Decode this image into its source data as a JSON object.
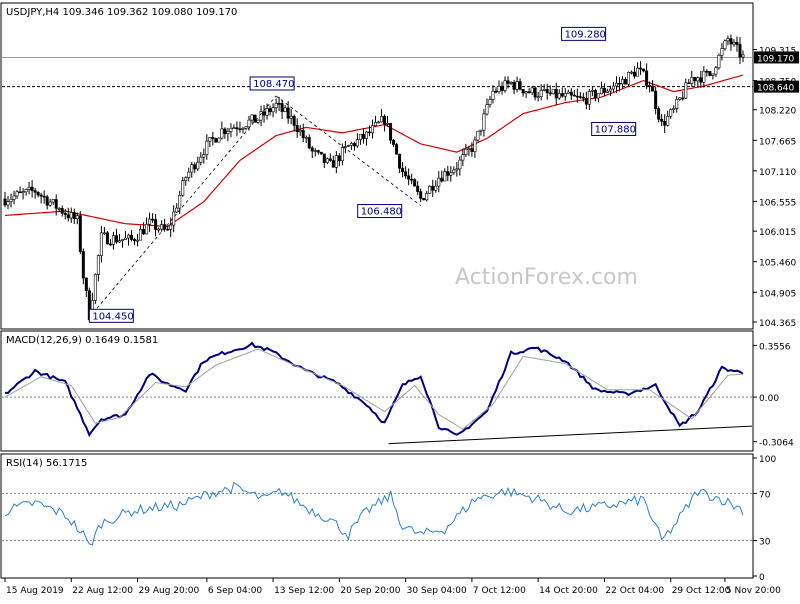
{
  "header": {
    "main": "USDJPY,H4  109.346 109.362 109.080 109.170",
    "macd": "MACD(12,26,9) 0.1649 0.1581",
    "rsi": "RSI(14) 56.1715"
  },
  "watermark": "ActionForex.com",
  "colors": {
    "candle": "#000000",
    "ma": "#d40000",
    "macd_main": "#00007f",
    "macd_signal": "#a0a0a0",
    "rsi": "#2a7fd4",
    "label_border": "#00007f",
    "label_text": "#00007f",
    "grid_dotted": "#888888",
    "watermark": "#c8c8c8"
  },
  "chart_data": [
    {
      "type": "candlestick",
      "panel": "price",
      "ylim": [
        104.365,
        109.85
      ],
      "y_ticks": [
        "109.315",
        "108.750",
        "108.220",
        "107.665",
        "107.110",
        "106.555",
        "106.015",
        "105.460",
        "104.905",
        "104.365"
      ],
      "price_tags": [
        {
          "value": 109.17,
          "label": "109.170",
          "line": "solid"
        },
        {
          "value": 108.64,
          "label": "108.640",
          "line": "dashed"
        }
      ],
      "annotations": [
        {
          "text": "104.450",
          "price": 104.45
        },
        {
          "text": "108.470",
          "price": 108.47
        },
        {
          "text": "106.480",
          "price": 106.48
        },
        {
          "text": "109.280",
          "price": 109.28
        },
        {
          "text": "107.880",
          "price": 107.88
        }
      ],
      "anchors": [
        {
          "i": 0,
          "p": 106.6
        },
        {
          "i": 10,
          "p": 106.75
        },
        {
          "i": 16,
          "p": 106.5
        },
        {
          "i": 24,
          "p": 106.2
        },
        {
          "i": 26,
          "p": 105.2
        },
        {
          "i": 28,
          "p": 104.5
        },
        {
          "i": 32,
          "p": 105.9
        },
        {
          "i": 42,
          "p": 105.85
        },
        {
          "i": 48,
          "p": 106.15
        },
        {
          "i": 54,
          "p": 106.0
        },
        {
          "i": 60,
          "p": 107.0
        },
        {
          "i": 66,
          "p": 107.5
        },
        {
          "i": 72,
          "p": 107.85
        },
        {
          "i": 78,
          "p": 107.95
        },
        {
          "i": 84,
          "p": 108.05
        },
        {
          "i": 90,
          "p": 108.3
        },
        {
          "i": 96,
          "p": 108.0
        },
        {
          "i": 102,
          "p": 107.45
        },
        {
          "i": 108,
          "p": 107.2
        },
        {
          "i": 114,
          "p": 107.55
        },
        {
          "i": 120,
          "p": 107.75
        },
        {
          "i": 126,
          "p": 108.05
        },
        {
          "i": 132,
          "p": 107.1
        },
        {
          "i": 138,
          "p": 106.6
        },
        {
          "i": 144,
          "p": 107.0
        },
        {
          "i": 150,
          "p": 107.2
        },
        {
          "i": 156,
          "p": 107.6
        },
        {
          "i": 162,
          "p": 108.55
        },
        {
          "i": 168,
          "p": 108.7
        },
        {
          "i": 174,
          "p": 108.55
        },
        {
          "i": 180,
          "p": 108.5
        },
        {
          "i": 186,
          "p": 108.45
        },
        {
          "i": 192,
          "p": 108.4
        },
        {
          "i": 198,
          "p": 108.55
        },
        {
          "i": 204,
          "p": 108.7
        },
        {
          "i": 210,
          "p": 108.95
        },
        {
          "i": 214,
          "p": 108.7
        },
        {
          "i": 218,
          "p": 107.95
        },
        {
          "i": 222,
          "p": 108.2
        },
        {
          "i": 228,
          "p": 108.8
        },
        {
          "i": 234,
          "p": 108.85
        },
        {
          "i": 240,
          "p": 109.5
        },
        {
          "i": 245,
          "p": 109.17
        }
      ],
      "ma_anchors": [
        {
          "i": 0,
          "p": 106.3
        },
        {
          "i": 20,
          "p": 106.38
        },
        {
          "i": 40,
          "p": 106.15
        },
        {
          "i": 54,
          "p": 106.1
        },
        {
          "i": 66,
          "p": 106.55
        },
        {
          "i": 78,
          "p": 107.3
        },
        {
          "i": 90,
          "p": 107.75
        },
        {
          "i": 100,
          "p": 107.9
        },
        {
          "i": 112,
          "p": 107.8
        },
        {
          "i": 126,
          "p": 107.95
        },
        {
          "i": 138,
          "p": 107.6
        },
        {
          "i": 150,
          "p": 107.45
        },
        {
          "i": 160,
          "p": 107.7
        },
        {
          "i": 172,
          "p": 108.15
        },
        {
          "i": 186,
          "p": 108.35
        },
        {
          "i": 198,
          "p": 108.45
        },
        {
          "i": 212,
          "p": 108.75
        },
        {
          "i": 222,
          "p": 108.55
        },
        {
          "i": 232,
          "p": 108.65
        },
        {
          "i": 245,
          "p": 108.85
        }
      ],
      "trendlines": [
        {
          "from": {
            "i": 28,
            "p": 104.45
          },
          "to": {
            "i": 90,
            "p": 108.47
          }
        },
        {
          "from": {
            "i": 90,
            "p": 108.47
          },
          "to": {
            "i": 138,
            "p": 106.48
          }
        }
      ]
    },
    {
      "type": "line",
      "panel": "macd",
      "ylim": [
        -0.35,
        0.42
      ],
      "y_ticks": [
        {
          "label": "0.3556",
          "value": 0.3556
        },
        {
          "label": "0.00",
          "value": 0.0
        },
        {
          "label": "-0.3064",
          "value": -0.3064
        }
      ],
      "series": [
        {
          "role": "main",
          "anchors": [
            {
              "i": 0,
              "p": 0.02
            },
            {
              "i": 10,
              "p": 0.18
            },
            {
              "i": 20,
              "p": 0.1
            },
            {
              "i": 28,
              "p": -0.25
            },
            {
              "i": 32,
              "p": -0.15
            },
            {
              "i": 40,
              "p": -0.12
            },
            {
              "i": 48,
              "p": 0.16
            },
            {
              "i": 54,
              "p": 0.09
            },
            {
              "i": 60,
              "p": 0.05
            },
            {
              "i": 66,
              "p": 0.25
            },
            {
              "i": 72,
              "p": 0.3
            },
            {
              "i": 82,
              "p": 0.36
            },
            {
              "i": 88,
              "p": 0.32
            },
            {
              "i": 100,
              "p": 0.18
            },
            {
              "i": 110,
              "p": 0.1
            },
            {
              "i": 120,
              "p": -0.05
            },
            {
              "i": 126,
              "p": -0.18
            },
            {
              "i": 132,
              "p": 0.08
            },
            {
              "i": 138,
              "p": 0.15
            },
            {
              "i": 144,
              "p": -0.2
            },
            {
              "i": 150,
              "p": -0.27
            },
            {
              "i": 160,
              "p": -0.1
            },
            {
              "i": 168,
              "p": 0.3
            },
            {
              "i": 176,
              "p": 0.34
            },
            {
              "i": 186,
              "p": 0.25
            },
            {
              "i": 196,
              "p": 0.05
            },
            {
              "i": 206,
              "p": 0.02
            },
            {
              "i": 216,
              "p": 0.08
            },
            {
              "i": 224,
              "p": -0.2
            },
            {
              "i": 230,
              "p": -0.1
            },
            {
              "i": 238,
              "p": 0.2
            },
            {
              "i": 245,
              "p": 0.165
            }
          ]
        },
        {
          "role": "signal",
          "anchors": [
            {
              "i": 0,
              "p": 0.0
            },
            {
              "i": 12,
              "p": 0.14
            },
            {
              "i": 22,
              "p": 0.08
            },
            {
              "i": 30,
              "p": -0.18
            },
            {
              "i": 38,
              "p": -0.14
            },
            {
              "i": 50,
              "p": 0.1
            },
            {
              "i": 60,
              "p": 0.07
            },
            {
              "i": 70,
              "p": 0.22
            },
            {
              "i": 84,
              "p": 0.33
            },
            {
              "i": 96,
              "p": 0.22
            },
            {
              "i": 112,
              "p": 0.08
            },
            {
              "i": 126,
              "p": -0.1
            },
            {
              "i": 136,
              "p": 0.08
            },
            {
              "i": 144,
              "p": -0.12
            },
            {
              "i": 152,
              "p": -0.22
            },
            {
              "i": 162,
              "p": -0.05
            },
            {
              "i": 172,
              "p": 0.28
            },
            {
              "i": 186,
              "p": 0.23
            },
            {
              "i": 200,
              "p": 0.05
            },
            {
              "i": 214,
              "p": 0.05
            },
            {
              "i": 228,
              "p": -0.15
            },
            {
              "i": 240,
              "p": 0.15
            },
            {
              "i": 245,
              "p": 0.158
            }
          ]
        }
      ],
      "trendline": {
        "from": {
          "i": 134,
          "p": -0.32
        },
        "to": {
          "i": 248,
          "p": -0.2
        }
      }
    },
    {
      "type": "line",
      "panel": "rsi",
      "ylim": [
        0,
        100
      ],
      "y_ticks": [
        {
          "label": "100",
          "value": 100
        },
        {
          "label": "70",
          "value": 70
        },
        {
          "label": "30",
          "value": 30
        },
        {
          "label": "0",
          "value": 0
        }
      ],
      "levels": [
        70,
        30
      ],
      "anchors": [
        {
          "i": 0,
          "p": 55
        },
        {
          "i": 10,
          "p": 62
        },
        {
          "i": 20,
          "p": 52
        },
        {
          "i": 26,
          "p": 35
        },
        {
          "i": 28,
          "p": 25
        },
        {
          "i": 32,
          "p": 45
        },
        {
          "i": 42,
          "p": 55
        },
        {
          "i": 50,
          "p": 58
        },
        {
          "i": 58,
          "p": 60
        },
        {
          "i": 68,
          "p": 70
        },
        {
          "i": 76,
          "p": 75
        },
        {
          "i": 86,
          "p": 65
        },
        {
          "i": 92,
          "p": 72
        },
        {
          "i": 100,
          "p": 58
        },
        {
          "i": 108,
          "p": 48
        },
        {
          "i": 114,
          "p": 35
        },
        {
          "i": 120,
          "p": 55
        },
        {
          "i": 128,
          "p": 68
        },
        {
          "i": 132,
          "p": 42
        },
        {
          "i": 138,
          "p": 35
        },
        {
          "i": 146,
          "p": 40
        },
        {
          "i": 156,
          "p": 65
        },
        {
          "i": 166,
          "p": 72
        },
        {
          "i": 176,
          "p": 66
        },
        {
          "i": 186,
          "p": 55
        },
        {
          "i": 196,
          "p": 58
        },
        {
          "i": 206,
          "p": 62
        },
        {
          "i": 212,
          "p": 65
        },
        {
          "i": 218,
          "p": 30
        },
        {
          "i": 222,
          "p": 42
        },
        {
          "i": 230,
          "p": 72
        },
        {
          "i": 238,
          "p": 65
        },
        {
          "i": 245,
          "p": 56
        }
      ]
    }
  ],
  "x_axis": {
    "total_bars": 246,
    "labels": [
      {
        "text": "15 Aug 2019",
        "i": 0
      },
      {
        "text": "22 Aug 12:00",
        "i": 22
      },
      {
        "text": "29 Aug 20:00",
        "i": 44
      },
      {
        "text": "6 Sep 04:00",
        "i": 67
      },
      {
        "text": "13 Sep 12:00",
        "i": 89
      },
      {
        "text": "20 Sep 20:00",
        "i": 111
      },
      {
        "text": "30 Sep 04:00",
        "i": 133
      },
      {
        "text": "7 Oct 12:00",
        "i": 155
      },
      {
        "text": "14 Oct 20:00",
        "i": 177
      },
      {
        "text": "22 Oct 04:00",
        "i": 199
      },
      {
        "text": "29 Oct 12:00",
        "i": 221
      },
      {
        "text": "5 Nov 20:00",
        "i": 239
      }
    ]
  }
}
